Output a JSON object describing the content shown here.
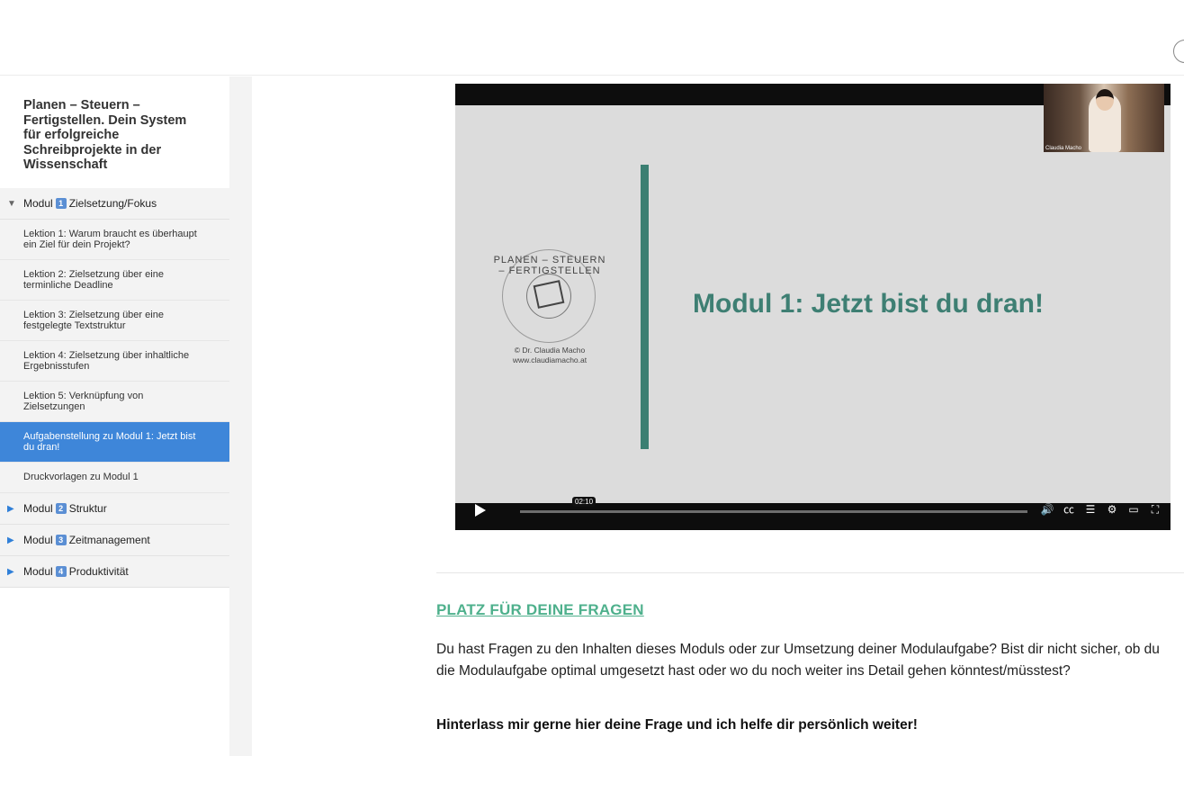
{
  "course": {
    "title": "Planen – Steuern – Fertigstellen. Dein System für erfolgreiche Schreibprojekte in der Wissenschaft"
  },
  "modules": [
    {
      "prefix": "Modul",
      "number": "1",
      "name": "Zielsetzung/Fokus",
      "expanded": true
    },
    {
      "prefix": "Modul",
      "number": "2",
      "name": "Struktur",
      "expanded": false
    },
    {
      "prefix": "Modul",
      "number": "3",
      "name": "Zeitmanagement",
      "expanded": false
    },
    {
      "prefix": "Modul",
      "number": "4",
      "name": "Produktivität",
      "expanded": false
    }
  ],
  "lessons": [
    "Lektion 1: Warum braucht es überhaupt ein Ziel für dein Projekt?",
    "Lektion 2: Zielsetzung über eine terminliche Deadline",
    "Lektion 3: Zielsetzung über eine festgelegte Textstruktur",
    "Lektion 4: Zielsetzung über inhaltliche Ergebnisstufen",
    "Lektion 5: Verknüpfung von Zielsetzungen",
    "Aufgabenstellung zu Modul 1: Jetzt bist du dran!",
    "Druckvorlagen zu Modul 1"
  ],
  "video": {
    "pip_label": "Claudia Macho",
    "logo_text": "PLANEN – STEUERN – FERTIGSTELLEN",
    "logo_copyright": "© Dr. Claudia Macho",
    "logo_url": "www.claudiamacho.at",
    "slide_title": "Modul 1: Jetzt bist du dran!",
    "time": "02:10",
    "progress_fraction": 0.0
  },
  "content": {
    "heading": "PLATZ FÜR DEINE FRAGEN",
    "paragraph": "Du hast Fragen zu den Inhalten dieses Moduls oder zur Umsetzung deiner Modulaufgabe? Bist dir nicht sicher, ob du die Modulaufgabe optimal umgesetzt hast oder wo du noch weiter ins Detail gehen könntest/müsstest?",
    "bold_line": "Hinterlass mir gerne hier deine Frage und ich helfe dir persönlich weiter!"
  },
  "colors": {
    "active_lesson": "#3e86d9",
    "accent_green": "#4eb08c",
    "slide_teal": "#3e7f73"
  }
}
